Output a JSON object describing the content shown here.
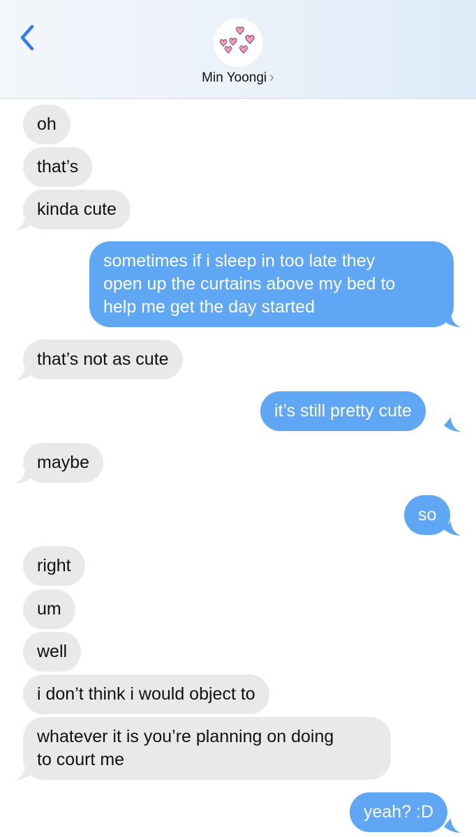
{
  "header": {
    "contact_name": "Min Yoongi",
    "chevron": "›",
    "back_icon": "chevron-left-icon",
    "avatar_icon": "hearts-icon",
    "accent_color": "#2f7bf6"
  },
  "colors": {
    "incoming_bubble": "#e9e9eb",
    "outgoing_bubble": "#5fa7f4"
  },
  "messages": [
    {
      "from": "them",
      "text": "oh"
    },
    {
      "from": "them",
      "text": "that’s"
    },
    {
      "from": "them",
      "text": "kinda cute"
    },
    {
      "from": "me",
      "lines": [
        "sometimes if i sleep in too late they",
        "open up the curtains above my bed to",
        "help me get the day started"
      ]
    },
    {
      "from": "them",
      "text": "that’s not as cute"
    },
    {
      "from": "me",
      "text": "it’s still pretty cute"
    },
    {
      "from": "them",
      "text": "maybe"
    },
    {
      "from": "me",
      "text": "so"
    },
    {
      "from": "them",
      "text": "right"
    },
    {
      "from": "them",
      "text": "um"
    },
    {
      "from": "them",
      "text": "well"
    },
    {
      "from": "them",
      "text": "i don’t think i would object to"
    },
    {
      "from": "them",
      "lines": [
        "whatever it is you’re planning on doing",
        "to court me"
      ]
    },
    {
      "from": "me",
      "text": "yeah? :D"
    }
  ]
}
